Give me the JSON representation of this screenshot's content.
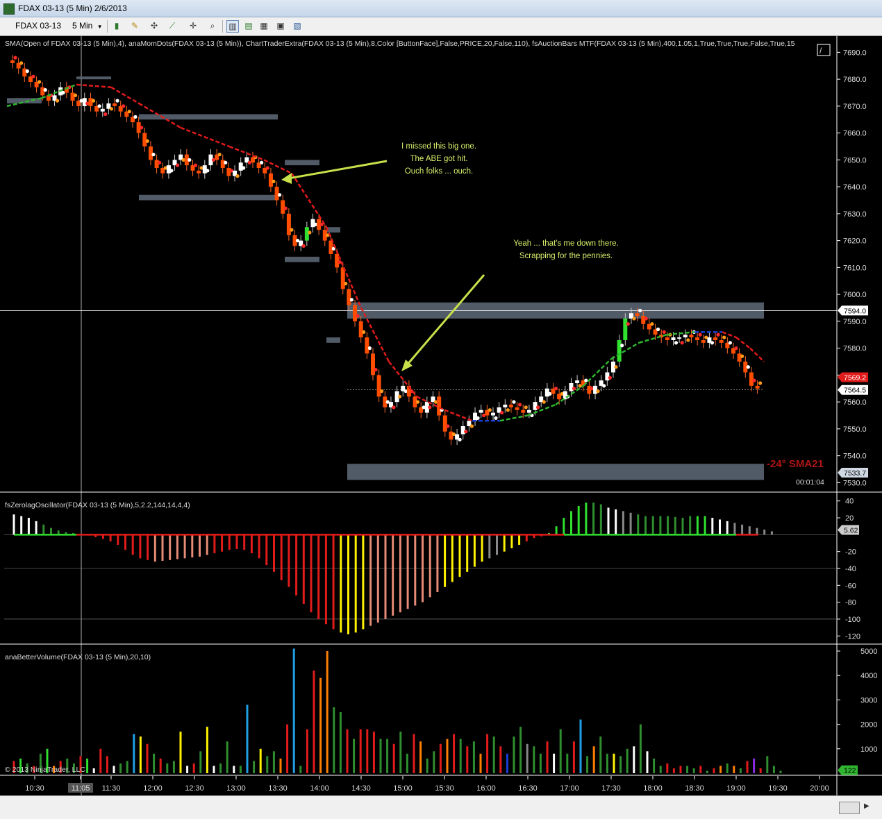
{
  "window": {
    "title": "FDAX 03-13 (5 Min)  2/6/2013"
  },
  "toolbar": {
    "instrument": "FDAX 03-13",
    "interval": "5 Min",
    "icons": [
      "bar-type-icon",
      "draw-pencil-icon",
      "crosshair-icon",
      "zoom-icon",
      "chart-trader-icon",
      "indicators-icon",
      "strategies-icon",
      "data-box-icon"
    ]
  },
  "chart_data": [
    {
      "type": "candlestick",
      "panel": "price",
      "legend": "SMA(Open of FDAX 03-13 (5 Min),4), anaMomDots(FDAX 03-13 (5 Min)), ChartTraderExtra(FDAX 03-13 (5 Min),8,Color [ButtonFace],False,PRICE,20,False,110), fsAuctionBars MTF(FDAX 03-13 (5 Min),400,1.05,1,True,True,True,False,True,15",
      "y_ticks": [
        7690.0,
        7680.0,
        7670.0,
        7660.0,
        7650.0,
        7640.0,
        7630.0,
        7620.0,
        7610.0,
        7600.0,
        7590.0,
        7580.0,
        7570.0,
        7560.0,
        7550.0,
        7540.0,
        7530.0
      ],
      "ylim": [
        7527,
        7695
      ],
      "price_labels": [
        {
          "value": 7594.0,
          "label": "7594.0",
          "color": "#ffffff"
        },
        {
          "value": 7569.2,
          "label": "7569.2",
          "color": "#e21b1b"
        },
        {
          "value": 7564.5,
          "label": "7564.5",
          "color": "#ffffff"
        },
        {
          "value": 7533.7,
          "label": "7533.7",
          "color": "#cfd8e3"
        }
      ],
      "close_series": [
        7686,
        7684,
        7681,
        7679,
        7677,
        7674,
        7672,
        7674,
        7677,
        7675,
        7672,
        7670,
        7673,
        7670,
        7668,
        7669,
        7671,
        7670,
        7668,
        7666,
        7664,
        7660,
        7655,
        7650,
        7647,
        7645,
        7648,
        7650,
        7652,
        7648,
        7646,
        7645,
        7648,
        7652,
        7650,
        7647,
        7644,
        7646,
        7649,
        7651,
        7649,
        7647,
        7645,
        7640,
        7635,
        7630,
        7622,
        7618,
        7620,
        7625,
        7628,
        7624,
        7620,
        7615,
        7610,
        7602,
        7596,
        7590,
        7584,
        7578,
        7570,
        7562,
        7558,
        7560,
        7564,
        7566,
        7562,
        7558,
        7556,
        7560,
        7562,
        7555,
        7549,
        7546,
        7548,
        7551,
        7553,
        7556,
        7557,
        7555,
        7556,
        7558,
        7559,
        7558,
        7557,
        7556,
        7557,
        7560,
        7562,
        7565,
        7563,
        7561,
        7564,
        7567,
        7568,
        7566,
        7563,
        7566,
        7568,
        7571,
        7575,
        7583,
        7591,
        7593,
        7592,
        7589,
        7587,
        7585,
        7584,
        7583,
        7584,
        7584,
        7585,
        7584,
        7583,
        7582,
        7584,
        7583,
        7582,
        7580,
        7578,
        7575,
        7571,
        7566,
        7565
      ],
      "first_bar_x": 18,
      "bar_spacing": 8.65,
      "lines": [
        {
          "name": "sma",
          "points": [
            [
              10,
              7670
            ],
            [
              60,
              7673
            ],
            [
              110,
              7678
            ],
            [
              160,
              7677
            ],
            [
              200,
              7671
            ],
            [
              260,
              7662
            ],
            [
              330,
              7655
            ],
            [
              380,
              7650
            ],
            [
              420,
              7645
            ],
            [
              470,
              7625
            ],
            [
              520,
              7595
            ],
            [
              560,
              7575
            ],
            [
              600,
              7562
            ],
            [
              640,
              7557
            ],
            [
              680,
              7553
            ],
            [
              720,
              7553
            ],
            [
              760,
              7555
            ],
            [
              800,
              7559
            ],
            [
              840,
              7566
            ],
            [
              880,
              7576
            ],
            [
              920,
              7582
            ],
            [
              960,
              7585
            ],
            [
              1000,
              7586
            ],
            [
              1040,
              7586
            ],
            [
              1060,
              7584
            ],
            [
              1080,
              7580
            ],
            [
              1100,
              7575
            ]
          ]
        }
      ],
      "zones": [
        {
          "from": 7591,
          "to": 7597,
          "x0": 500,
          "x1": 1100
        },
        {
          "from": 7531,
          "to": 7537,
          "x0": 500,
          "x1": 1100
        },
        {
          "from": 7635,
          "to": 7637,
          "x0": 200,
          "x1": 400
        },
        {
          "from": 7665,
          "to": 7667,
          "x0": 200,
          "x1": 400
        },
        {
          "from": 7671,
          "to": 7673,
          "x0": 10,
          "x1": 60
        },
        {
          "from": 7680,
          "to": 7681,
          "x0": 110,
          "x1": 160
        },
        {
          "from": 7648,
          "to": 7650,
          "x0": 410,
          "x1": 460
        },
        {
          "from": 7612,
          "to": 7614,
          "x0": 410,
          "x1": 460
        },
        {
          "from": 7623,
          "to": 7625,
          "x0": 470,
          "x1": 490
        },
        {
          "from": 7582,
          "to": 7584,
          "x0": 470,
          "x1": 490
        }
      ],
      "crosshair_price": 7594.0,
      "annotations": [
        {
          "lines": [
            "I missed this big one.",
            "The ABE got hit.",
            "Ouch folks ... ouch."
          ]
        },
        {
          "lines": [
            "Yeah ... that's me down there.",
            "Scrapping for the pennies."
          ]
        }
      ],
      "sma_label": "-24°  SMA21",
      "timer": "00:01:04"
    },
    {
      "type": "bar",
      "panel": "oscillator",
      "legend": "fsZerolagOscillator(FDAX 03-13 (5 Min),5,2.2,144,14,4,4)",
      "y_ticks": [
        40,
        20,
        -20,
        -40,
        -60,
        -80,
        -100,
        -120
      ],
      "ylim": [
        -128,
        48
      ],
      "last_value_label": "5.62",
      "values": [
        24,
        22,
        20,
        16,
        12,
        8,
        5,
        3,
        2,
        1,
        -1,
        -3,
        -5,
        -8,
        -12,
        -18,
        -24,
        -28,
        -30,
        -32,
        -31,
        -30,
        -29,
        -28,
        -27,
        -26,
        -24,
        -22,
        -20,
        -18,
        -17,
        -18,
        -22,
        -28,
        -36,
        -44,
        -54,
        -62,
        -72,
        -82,
        -92,
        -100,
        -106,
        -112,
        -116,
        -118,
        -116,
        -112,
        -108,
        -104,
        -100,
        -96,
        -92,
        -88,
        -84,
        -80,
        -74,
        -68,
        -62,
        -56,
        -50,
        -44,
        -38,
        -32,
        -28,
        -24,
        -20,
        -16,
        -12,
        -8,
        -4,
        -2,
        2,
        10,
        20,
        28,
        34,
        38,
        38,
        36,
        32,
        30,
        28,
        26,
        24,
        22,
        22,
        22,
        22,
        21,
        20,
        22,
        22,
        22,
        20,
        18,
        16,
        14,
        12,
        10,
        8,
        6,
        4
      ],
      "colors": [
        "#fff",
        "#fff",
        "#fff",
        "#fff",
        "#2f8f2f",
        "#2f8f2f",
        "#2f8f2f",
        "#2f8f2f",
        "#2f8f2f",
        "#2f8f2f",
        "#e21b1b",
        "#e21b1b",
        "#e21b1b",
        "#e21b1b",
        "#e21b1b",
        "#e21b1b",
        "#e21b1b",
        "#e21b1b",
        "#e21b1b",
        "#e58b77",
        "#e58b77",
        "#e58b77",
        "#e58b77",
        "#e58b77",
        "#e58b77",
        "#e58b77",
        "#e58b77",
        "#e21b1b",
        "#e21b1b",
        "#e21b1b",
        "#e21b1b",
        "#e21b1b",
        "#e21b1b",
        "#e21b1b",
        "#e21b1b",
        "#e21b1b",
        "#e21b1b",
        "#e21b1b",
        "#e21b1b",
        "#e21b1b",
        "#e21b1b",
        "#e21b1b",
        "#e21b1b",
        "#e21b1b",
        "#fff200",
        "#fff200",
        "#fff200",
        "#fff200",
        "#e58b77",
        "#e58b77",
        "#e58b77",
        "#e58b77",
        "#e58b77",
        "#e58b77",
        "#e58b77",
        "#e58b77",
        "#e58b77",
        "#e58b77",
        "#fff200",
        "#fff200",
        "#fff200",
        "#fff200",
        "#fff200",
        "#fff200",
        "#888888",
        "#888888",
        "#fff200",
        "#fff200",
        "#fff200",
        "#e21b1b",
        "#e21b1b",
        "#e21b1b",
        "#2fe02f",
        "#2fe02f",
        "#2fe02f",
        "#2fe02f",
        "#2fe02f",
        "#2fe02f",
        "#2f8f2f",
        "#2f8f2f",
        "#fff",
        "#fff",
        "#888",
        "#888",
        "#2f8f2f",
        "#2f8f2f",
        "#2f8f2f",
        "#2f8f2f",
        "#2f8f2f",
        "#2f8f2f",
        "#2f8f2f",
        "#2f8f2f",
        "#2fe02f",
        "#2fe02f",
        "#fff",
        "#fff",
        "#fff",
        "#888",
        "#888",
        "#888",
        "#888",
        "#888",
        "#888"
      ]
    },
    {
      "type": "bar",
      "panel": "volume",
      "legend": "anaBetterVolume(FDAX 03-13 (5 Min),20,10)",
      "y_ticks": [
        5000,
        4000,
        3000,
        2000,
        1000
      ],
      "ylim": [
        0,
        5200
      ],
      "last_value_label": "122",
      "values": [
        500,
        600,
        400,
        300,
        800,
        1000,
        300,
        500,
        600,
        400,
        700,
        600,
        200,
        1000,
        700,
        300,
        400,
        500,
        1600,
        1500,
        1200,
        800,
        600,
        400,
        500,
        1700,
        300,
        400,
        900,
        1900,
        300,
        400,
        1300,
        300,
        300,
        2800,
        500,
        1000,
        700,
        900,
        600,
        2000,
        5100,
        300,
        1800,
        4200,
        3900,
        5000,
        2700,
        2500,
        1800,
        1400,
        1800,
        1800,
        1700,
        1400,
        1400,
        1200,
        1700,
        800,
        1600,
        1300,
        600,
        900,
        1200,
        1400,
        1600,
        1400,
        1100,
        1300,
        800,
        1600,
        1500,
        1100,
        800,
        1500,
        1900,
        1200,
        1100,
        800,
        1300,
        800,
        1800,
        800,
        1300,
        2200,
        700,
        1100,
        1500,
        800,
        800,
        700,
        1000,
        1100,
        2000,
        900,
        600,
        300,
        400,
        200,
        300,
        300,
        200,
        300,
        100,
        200,
        300,
        400,
        300,
        200,
        500,
        600,
        200,
        700,
        300,
        100
      ],
      "colors": [
        "#e21b1b",
        "#2fe02f",
        "#2f8f2f",
        "#e21b1b",
        "#2f8f2f",
        "#2fe02f",
        "#ff7f00",
        "#e21b1b",
        "#2f8f2f",
        "#2f8f2f",
        "#e21b1b",
        "#2fe02f",
        "#fff",
        "#e21b1b",
        "#e21b1b",
        "#fff",
        "#2f8f2f",
        "#2f8f2f",
        "#1fa0e6",
        "#fff200",
        "#e21b1b",
        "#2f8f2f",
        "#e21b1b",
        "#2f8f2f",
        "#2f8f2f",
        "#fff200",
        "#fff",
        "#e21b1b",
        "#2f8f2f",
        "#fff200",
        "#fff",
        "#2f8f2f",
        "#2f8f2f",
        "#fff",
        "#2f8f2f",
        "#1fa0e6",
        "#2f8f2f",
        "#fff200",
        "#2f8f2f",
        "#2f8f2f",
        "#ff7f00",
        "#e21b1b",
        "#1fa0e6",
        "#2f8f2f",
        "#e21b1b",
        "#e21b1b",
        "#ff7f00",
        "#ff7f00",
        "#2f8f2f",
        "#2f8f2f",
        "#e21b1b",
        "#2f8f2f",
        "#e21b1b",
        "#e21b1b",
        "#e21b1b",
        "#2f8f2f",
        "#2f8f2f",
        "#e21b1b",
        "#2f8f2f",
        "#2f8f2f",
        "#e21b1b",
        "#ff7f00",
        "#2f8f2f",
        "#2f8f2f",
        "#e21b1b",
        "#ff7f00",
        "#e21b1b",
        "#2f8f2f",
        "#e21b1b",
        "#2f8f2f",
        "#ff7f00",
        "#e21b1b",
        "#2f8f2f",
        "#e21b1b",
        "#1a3fd6",
        "#2f8f2f",
        "#2f8f2f",
        "#888888",
        "#2f8f2f",
        "#2f8f2f",
        "#e21b1b",
        "#fff",
        "#2f8f2f",
        "#2f8f2f",
        "#e21b1b",
        "#1fa0e6",
        "#2f8f2f",
        "#ff7f00",
        "#2f8f2f",
        "#2f8f2f",
        "#fff200",
        "#2f8f2f",
        "#2f8f2f",
        "#fff",
        "#2f8f2f",
        "#fff",
        "#2f8f2f",
        "#2f8f2f",
        "#e21b1b",
        "#e21b1b",
        "#e21b1b",
        "#2f8f2f",
        "#2f8f2f",
        "#e21b1b",
        "#2f8f2f",
        "#e21b1b",
        "#ff7f00",
        "#2f8f2f",
        "#ff7f00",
        "#2f8f2f",
        "#e21b1b",
        "#8a2be2",
        "#e21b1b",
        "#2f8f2f"
      ]
    }
  ],
  "x_axis": {
    "tick_labels": [
      "10:30",
      "11:05",
      "11:30",
      "12:00",
      "12:30",
      "13:00",
      "13:30",
      "14:00",
      "14:30",
      "15:00",
      "15:30",
      "16:00",
      "16:30",
      "17:00",
      "17:30",
      "18:00",
      "18:30",
      "19:00",
      "19:30",
      "20:00"
    ],
    "highlighted_label": "11:05"
  },
  "copyright": "© 2013 NinjaTrader, LLC",
  "colors": {
    "background": "#000000",
    "up_candle": "#2fe02f",
    "down_candle": "#ff4d00",
    "zone": "#5a6472",
    "axis_text": "#dddddd",
    "annotation_text": "#d6f06b",
    "sma_up": "#2fb52f",
    "sma_down": "#e21b1b",
    "sma_flat": "#1a3fd6"
  }
}
